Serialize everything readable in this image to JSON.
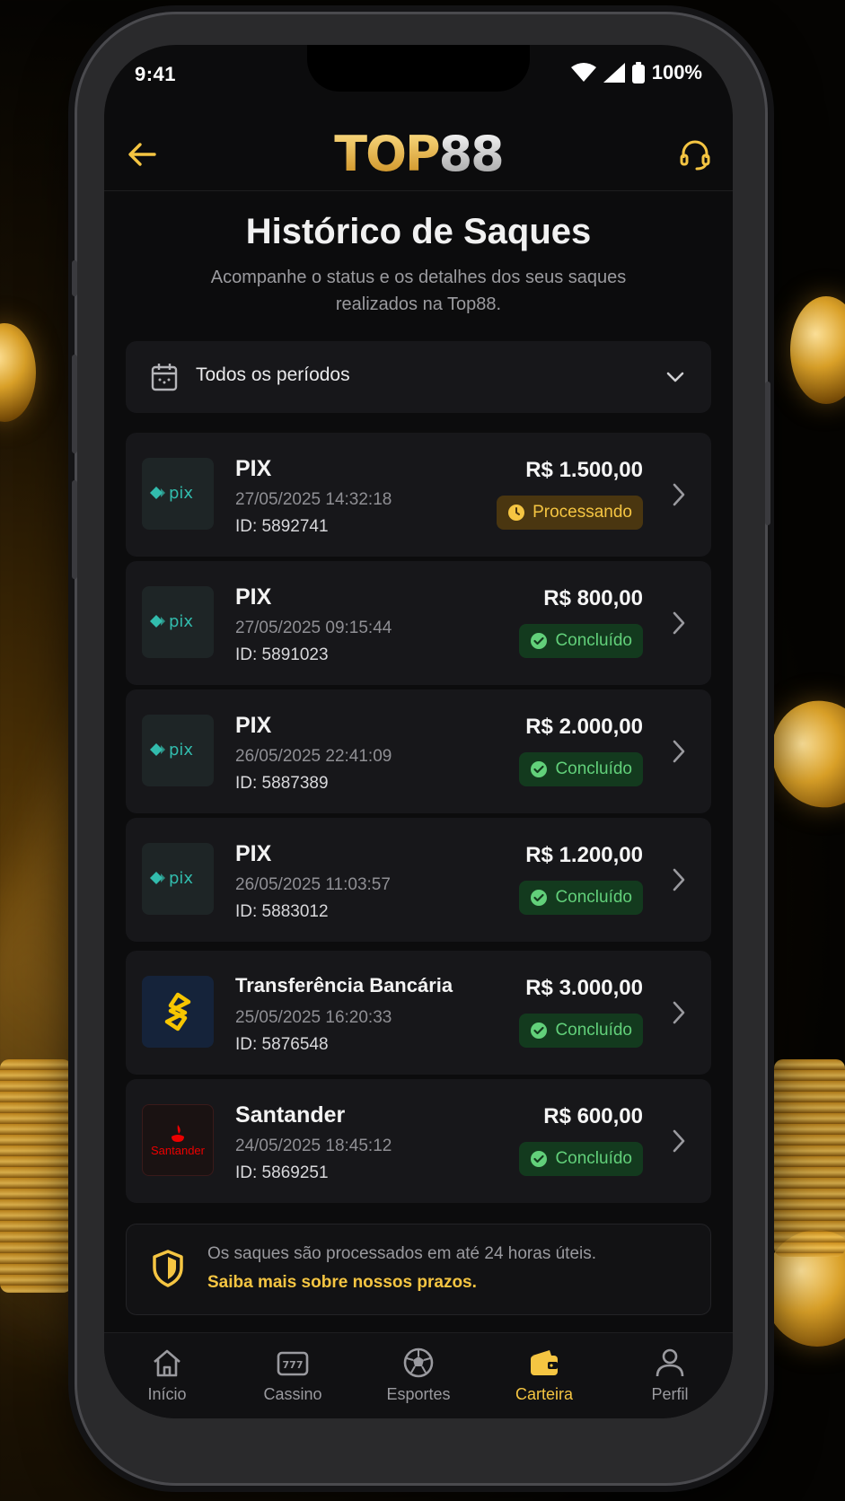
{
  "status_bar": {
    "time": "9:41",
    "battery": "100%"
  },
  "header": {
    "logo_part1": "TOP",
    "logo_part2": "88"
  },
  "page": {
    "title": "Histórico de Saques",
    "subtitle": "Acompanhe o status e os detalhes dos seus saques realizados na Top88."
  },
  "filter": {
    "label": "Todos os períodos"
  },
  "withdrawals": [
    {
      "method": "PIX",
      "date": "27/05/2025 14:32:18",
      "id": "ID: 5892741",
      "amount": "R$ 1.500,00",
      "status": "Processando",
      "status_type": "processing",
      "logo": "pix"
    },
    {
      "method": "PIX",
      "date": "27/05/2025 09:15:44",
      "id": "ID: 5891023",
      "amount": "R$ 800,00",
      "status": "Concluído",
      "status_type": "done",
      "logo": "pix"
    },
    {
      "method": "PIX",
      "date": "26/05/2025 22:41:09",
      "id": "ID: 5887389",
      "amount": "R$ 2.000,00",
      "status": "Concluído",
      "status_type": "done",
      "logo": "pix"
    },
    {
      "method": "PIX",
      "date": "26/05/2025 11:03:57",
      "id": "ID: 5883012",
      "amount": "R$ 1.200,00",
      "status": "Concluído",
      "status_type": "done",
      "logo": "pix"
    },
    {
      "method": "Transferência Bancária",
      "date": "25/05/2025 16:20:33",
      "id": "ID: 5876548",
      "amount": "R$ 3.000,00",
      "status": "Concluído",
      "status_type": "done",
      "logo": "banco-do-brasil"
    },
    {
      "method": "Santander",
      "date": "24/05/2025 18:45:12",
      "id": "ID: 5869251",
      "amount": "R$ 600,00",
      "status": "Concluído",
      "status_type": "done",
      "logo": "santander",
      "logo_text": "Santander"
    }
  ],
  "notice": {
    "text": "Os saques são processados em até 24 horas úteis.",
    "link": "Saiba mais sobre nossos prazos."
  },
  "nav": [
    {
      "label": "Início",
      "icon": "home-icon"
    },
    {
      "label": "Cassino",
      "icon": "slot-machine-icon"
    },
    {
      "label": "Esportes",
      "icon": "soccer-ball-icon"
    },
    {
      "label": "Carteira",
      "icon": "wallet-icon",
      "active": true
    },
    {
      "label": "Perfil",
      "icon": "user-icon"
    }
  ],
  "colors": {
    "accent": "#f5c542",
    "success": "#62d07a",
    "background": "#0c0c0d",
    "card": "#17171a"
  }
}
